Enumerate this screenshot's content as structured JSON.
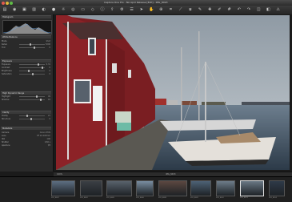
{
  "window": {
    "title": "Capture One Pro - NA April Release [Edit] - IMG_8493",
    "colors": {
      "close": "#e25b4e",
      "minimize": "#e0b63a",
      "zoom": "#5fbd45"
    }
  },
  "toolbar": {
    "icons": [
      "import-icon",
      "capture-icon",
      "folder-icon",
      "library-icon",
      "adjust-icon",
      "color-icon",
      "exposure-icon",
      "lens-icon",
      "composition-icon",
      "details-icon",
      "metadata-icon",
      "output-icon",
      "batch-icon",
      "settings-icon",
      "cursor-icon",
      "pan-icon",
      "zoom-icon",
      "crop-icon",
      "straighten-icon",
      "keystone-icon",
      "spot-icon",
      "picker-icon",
      "annotate-icon",
      "grid-icon",
      "undo-icon",
      "redo-icon",
      "proof-icon",
      "compare-icon",
      "exposure-warning-icon"
    ]
  },
  "left_panel": {
    "histogram_title": "Histogram",
    "sections": [
      {
        "title": "White Balance"
      },
      {
        "title": "Exposure"
      },
      {
        "title": "High Dynamic Range"
      },
      {
        "title": "Clarity"
      },
      {
        "title": "Metadata"
      }
    ],
    "rows": [
      {
        "label": "Mode",
        "value": "Shot"
      },
      {
        "label": "Kelvin",
        "value": "5200"
      },
      {
        "label": "Tint",
        "value": "0"
      },
      {
        "label": "Exposure",
        "value": "0.31"
      },
      {
        "label": "Contrast",
        "value": "0"
      },
      {
        "label": "Brightness",
        "value": "0"
      },
      {
        "label": "Saturation",
        "value": "0"
      },
      {
        "label": "Highlight",
        "value": "49"
      },
      {
        "label": "Shadow",
        "value": "16"
      },
      {
        "label": "Clarity",
        "value": "21"
      },
      {
        "label": "Structure",
        "value": "0"
      },
      {
        "label": "Camera",
        "value": "Canon EOS"
      },
      {
        "label": "Lens",
        "value": "EF 24-105mm"
      },
      {
        "label": "ISO",
        "value": "100"
      },
      {
        "label": "Shutter",
        "value": "1/60 s"
      },
      {
        "label": "Aperture",
        "value": "f/8"
      }
    ]
  },
  "viewer": {
    "filename": "IMG_8493",
    "strip_left": "100%",
    "strip_right": "IMG_8493"
  },
  "filmstrip": {
    "thumbs": [
      {
        "label": "IMG_8481"
      },
      {
        "label": "IMG_8482"
      },
      {
        "label": "IMG_8485"
      },
      {
        "label": "IMG_8486"
      },
      {
        "label": "IMG_8488"
      },
      {
        "label": "IMG_8489"
      },
      {
        "label": "IMG_8490"
      },
      {
        "label": "IMG_8493"
      },
      {
        "label": "IMG_8494"
      }
    ]
  }
}
